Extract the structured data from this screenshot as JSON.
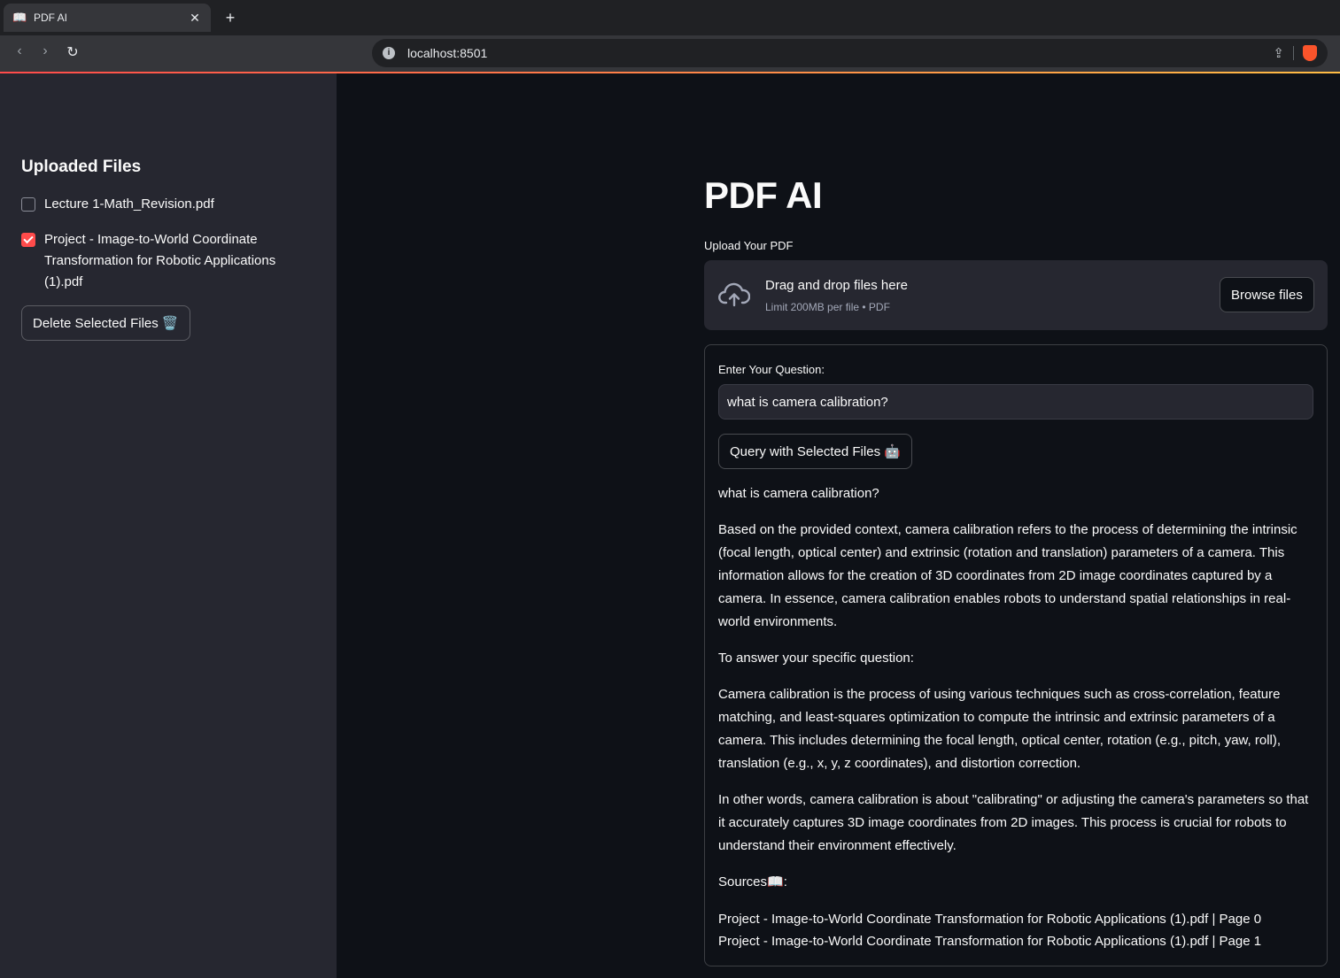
{
  "browser": {
    "tab_title": "PDF AI",
    "tab_favicon": "📖",
    "url": "localhost:8501"
  },
  "sidebar": {
    "title": "Uploaded Files",
    "files": [
      {
        "label": "Lecture 1-Math_Revision.pdf",
        "checked": false
      },
      {
        "label": "Project - Image-to-World Coordinate Transformation for Robotic Applications (1).pdf",
        "checked": true
      }
    ],
    "delete_button": "Delete Selected Files 🗑️"
  },
  "main": {
    "title": "PDF AI",
    "upload_label": "Upload Your PDF",
    "dropzone": {
      "title": "Drag and drop files here",
      "subtitle": "Limit 200MB per file • PDF",
      "browse_button": "Browse files"
    },
    "question_label": "Enter Your Question:",
    "question_value": "what is camera calibration?",
    "query_button": "Query with Selected Files 🤖",
    "answer": {
      "question": "what is camera calibration?",
      "paragraphs": [
        "Based on the provided context, camera calibration refers to the process of determining the intrinsic (focal length, optical center) and extrinsic (rotation and translation) parameters of a camera. This information allows for the creation of 3D coordinates from 2D image coordinates captured by a camera. In essence, camera calibration enables robots to understand spatial relationships in real-world environments.",
        "To answer your specific question:",
        "Camera calibration is the process of using various techniques such as cross-correlation, feature matching, and least-squares optimization to compute the intrinsic and extrinsic parameters of a camera. This includes determining the focal length, optical center, rotation (e.g., pitch, yaw, roll), translation (e.g., x, y, z coordinates), and distortion correction.",
        "In other words, camera calibration is about \"calibrating\" or adjusting the camera's parameters so that it accurately captures 3D image coordinates from 2D images. This process is crucial for robots to understand their environment effectively."
      ],
      "sources_label": "Sources📖:",
      "sources": [
        "Project - Image-to-World Coordinate Transformation for Robotic Applications (1).pdf | Page 0",
        "Project - Image-to-World Coordinate Transformation for Robotic Applications (1).pdf | Page 1"
      ]
    }
  },
  "colors": {
    "accent": "#ff4b4b",
    "background": "#0e1117",
    "sidebar": "#262730"
  }
}
